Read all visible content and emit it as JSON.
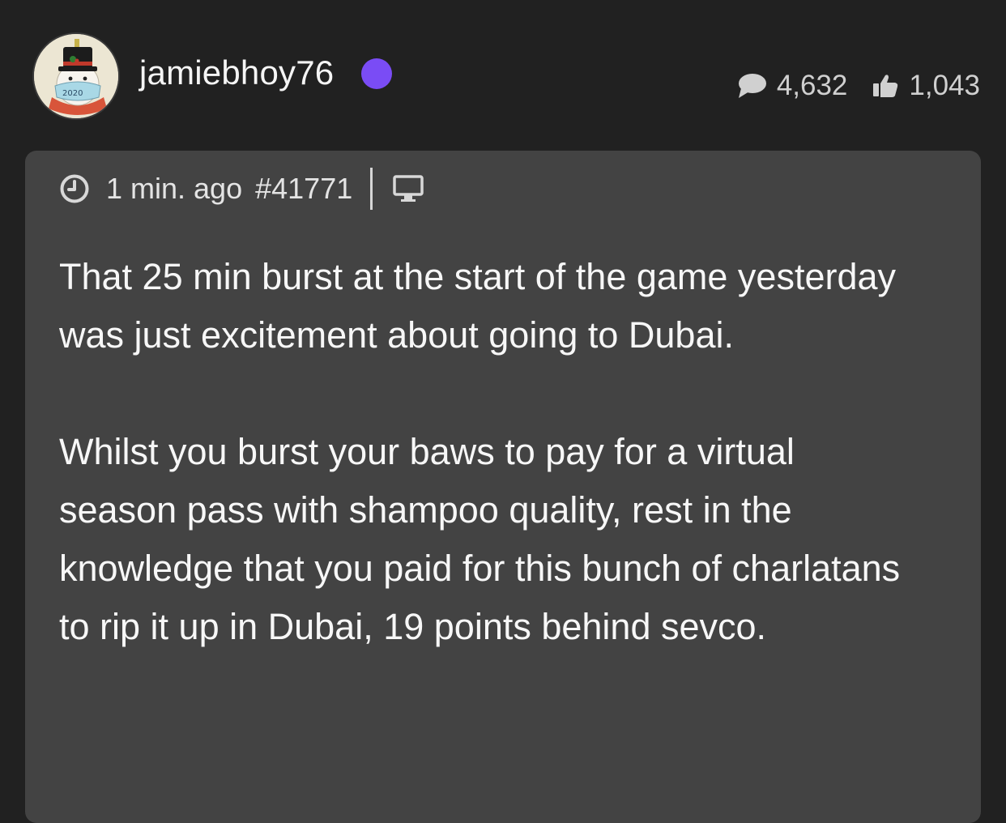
{
  "user": {
    "name": "jamiebhoy76",
    "avatar_label": "2020",
    "status_color": "#7a4cf5",
    "avatar_icon": "snowman-avatar"
  },
  "stats": {
    "comments": "4,632",
    "likes": "1,043",
    "comments_icon": "speech-bubble-icon",
    "likes_icon": "thumbs-up-icon"
  },
  "post": {
    "time": "1 min. ago",
    "number": "#41771",
    "device_icon": "desktop-icon",
    "paragraphs": [
      "That 25 min burst at the start of the game yesterday was just excitement about going to Dubai.",
      "Whilst you burst your baws to pay for a virtual season pass with shampoo quality, rest in the knowledge that you paid for this bunch of charlatans to rip it up in Dubai, 19 points behind sevco."
    ]
  }
}
